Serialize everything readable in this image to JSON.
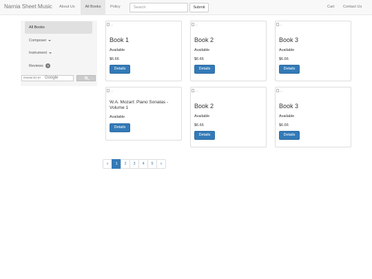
{
  "navbar": {
    "brand": "Narnia Sheet Music",
    "links": [
      "About Us",
      "All Books",
      "Policy"
    ],
    "search_placeholder": "Search",
    "submit_label": "Submit",
    "right_links": [
      "Cart",
      "Contact Us"
    ]
  },
  "sidebar": {
    "items": [
      {
        "label": "All Books"
      },
      {
        "label": "Composer"
      },
      {
        "label": "Instrument"
      },
      {
        "label": "Reviews",
        "badge": "0"
      }
    ],
    "gsearch_label": "ENHANCED BY",
    "gsearch_logo": "Google"
  },
  "products": [
    {
      "img_alt": "...",
      "title": "Book 1",
      "status": "Available",
      "price": "$6.66",
      "button": "Details"
    },
    {
      "img_alt": "...",
      "title": "Book 2",
      "status": "Available",
      "price": "$6.66",
      "button": "Details"
    },
    {
      "img_alt": "...",
      "title": "Book 3",
      "status": "Available",
      "price": "$6.66",
      "button": "Details"
    },
    {
      "img_alt": "...",
      "title": "W.A. Mozart: Piano Sonatas - Volume 1",
      "status": "Available",
      "price": "",
      "button": "Details"
    },
    {
      "img_alt": "...",
      "title": "Book 2",
      "status": "Available",
      "price": "$6.66",
      "button": "Details"
    },
    {
      "img_alt": "...",
      "title": "Book 3",
      "status": "Available",
      "price": "$6.66",
      "button": "Details"
    }
  ],
  "pagination": {
    "prev": "«",
    "pages": [
      "1",
      "2",
      "3",
      "4",
      "5"
    ],
    "current": "1",
    "next": "»"
  },
  "colors": {
    "primary": "#337ab7",
    "navbar_bg": "#f8f8f8",
    "sidebar_bg": "#f5f5f5"
  }
}
